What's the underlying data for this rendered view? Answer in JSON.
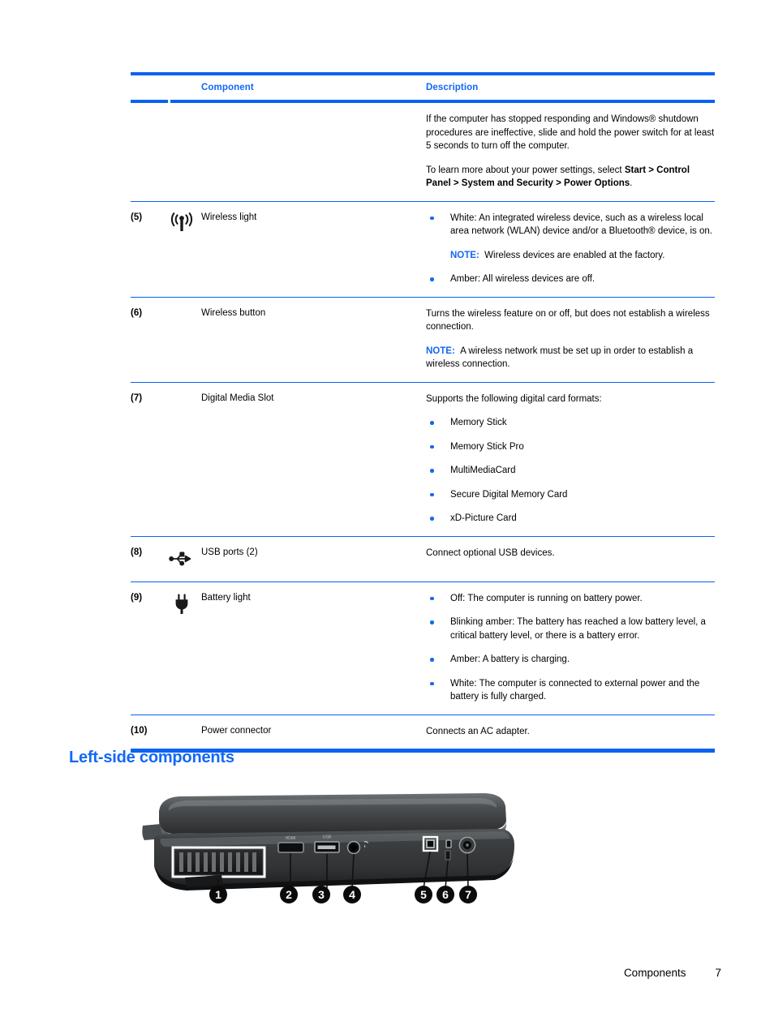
{
  "table": {
    "headers": {
      "component": "Component",
      "description": "Description"
    },
    "rows": [
      {
        "num": "",
        "icon": "",
        "name": "",
        "desc_paragraphs": [
          "If the computer has stopped responding and Windows® shutdown procedures are ineffective, slide and hold the power switch for at least 5 seconds to turn off the computer.",
          "To learn more about your power settings, select "
        ],
        "desc_bold_tail": "Start > Control Panel > System and Security > Power Options",
        "desc_tail_period": "."
      },
      {
        "num": "(5)",
        "icon": "wireless-icon",
        "name": "Wireless light",
        "bullets": [
          "White: An integrated wireless device, such as a wireless local area network (WLAN) device and/or a Bluetooth® device, is on.",
          "Amber: All wireless devices are off."
        ],
        "note_label": "NOTE:",
        "note_text": "Wireless devices are enabled at the factory."
      },
      {
        "num": "(6)",
        "icon": "",
        "name": "Wireless button",
        "desc": "Turns the wireless feature on or off, but does not establish a wireless connection.",
        "note_label": "NOTE:",
        "note_text": "A wireless network must be set up in order to establish a wireless connection."
      },
      {
        "num": "(7)",
        "icon": "",
        "name": "Digital Media Slot",
        "desc": "Supports the following digital card formats:",
        "bullets": [
          "Memory Stick",
          "Memory Stick Pro",
          "MultiMediaCard",
          "Secure Digital Memory Card",
          "xD-Picture Card"
        ]
      },
      {
        "num": "(8)",
        "icon": "usb-icon",
        "name": "USB ports (2)",
        "desc": "Connect optional USB devices."
      },
      {
        "num": "(9)",
        "icon": "power-plug-icon",
        "name": "Battery light",
        "bullets": [
          "Off: The computer is running on battery power.",
          "Blinking amber: The battery has reached a low battery level, a critical battery level, or there is a battery error.",
          "Amber: A battery is charging.",
          "White: The computer is connected to external power and the battery is fully charged."
        ]
      },
      {
        "num": "(10)",
        "icon": "",
        "name": "Power connector",
        "desc": "Connects an AC adapter."
      }
    ]
  },
  "section": {
    "heading": "Left-side components"
  },
  "figure": {
    "alt": "left-side-components-photo",
    "callouts": [
      "1",
      "2",
      "3",
      "4",
      "5",
      "6",
      "7"
    ]
  },
  "footer": {
    "chapter": "Components",
    "page": "7"
  },
  "colors": {
    "accent_blue": "#1268f5",
    "rule_blue": "#0a62f0",
    "text_black": "#000000"
  }
}
